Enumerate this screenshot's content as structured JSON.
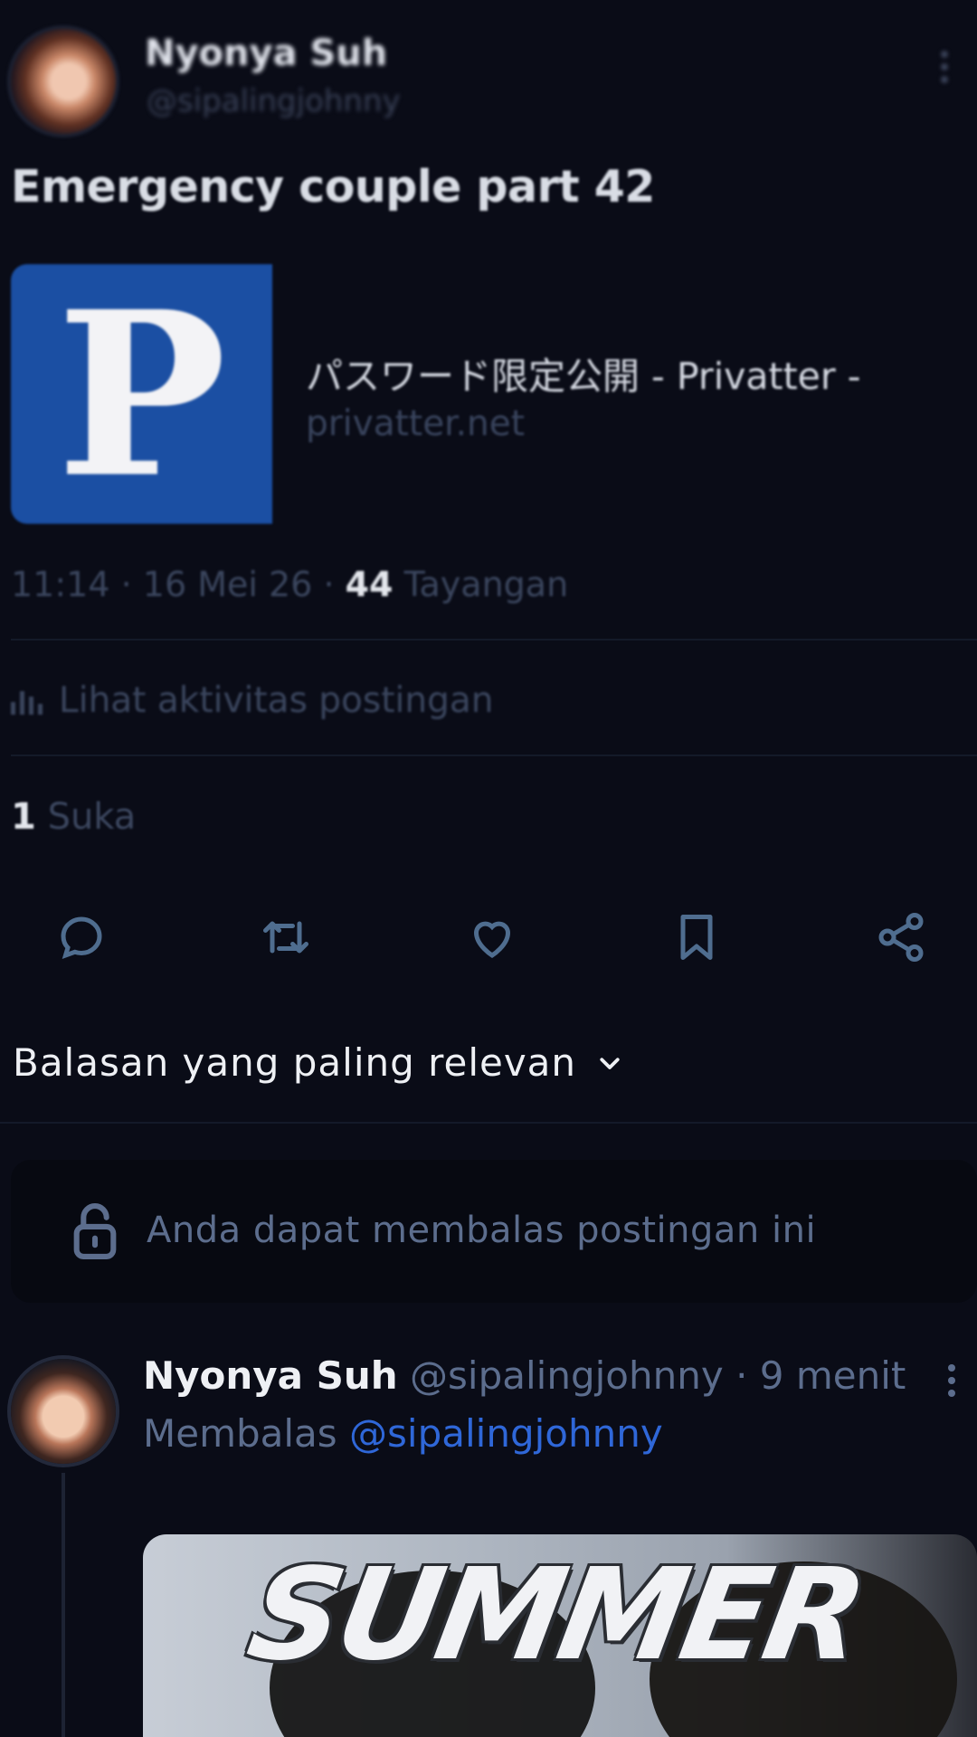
{
  "post": {
    "author_name": "Nyonya Suh",
    "author_handle": "@sipalingjohnny",
    "text": "Emergency couple part 42",
    "link_card": {
      "title": "パスワード限定公開 - Privatter -",
      "domain": "privatter.net",
      "logo_letter": "P",
      "logo_color": "#1b4fa3"
    },
    "time": "11:14",
    "date": "16 Mei 26",
    "views_count": "44",
    "views_label": "Tayangan",
    "activity_label": "Lihat aktivitas postingan",
    "likes_count": "1",
    "likes_label": "Suka"
  },
  "actions": [
    {
      "name": "reply",
      "icon": "reply-icon"
    },
    {
      "name": "repost",
      "icon": "repost-icon"
    },
    {
      "name": "like",
      "icon": "heart-icon"
    },
    {
      "name": "bookmark",
      "icon": "bookmark-icon"
    },
    {
      "name": "share",
      "icon": "share-icon"
    }
  ],
  "replies": {
    "sort_label": "Balasan yang paling relevan",
    "reply_prompt": "Anda dapat membalas postingan ini",
    "items": [
      {
        "author_name": "Nyonya Suh",
        "author_handle": "@sipalingjohnny",
        "time": "9 menit",
        "replying_label": "Membalas",
        "replying_to": "@sipalingjohnny",
        "media_text": "SUMMER"
      }
    ]
  },
  "colors": {
    "background": "#0a0c17",
    "muted": "#5c6d8d",
    "mention": "#2f67d8",
    "icon": "#4f6d8f"
  }
}
